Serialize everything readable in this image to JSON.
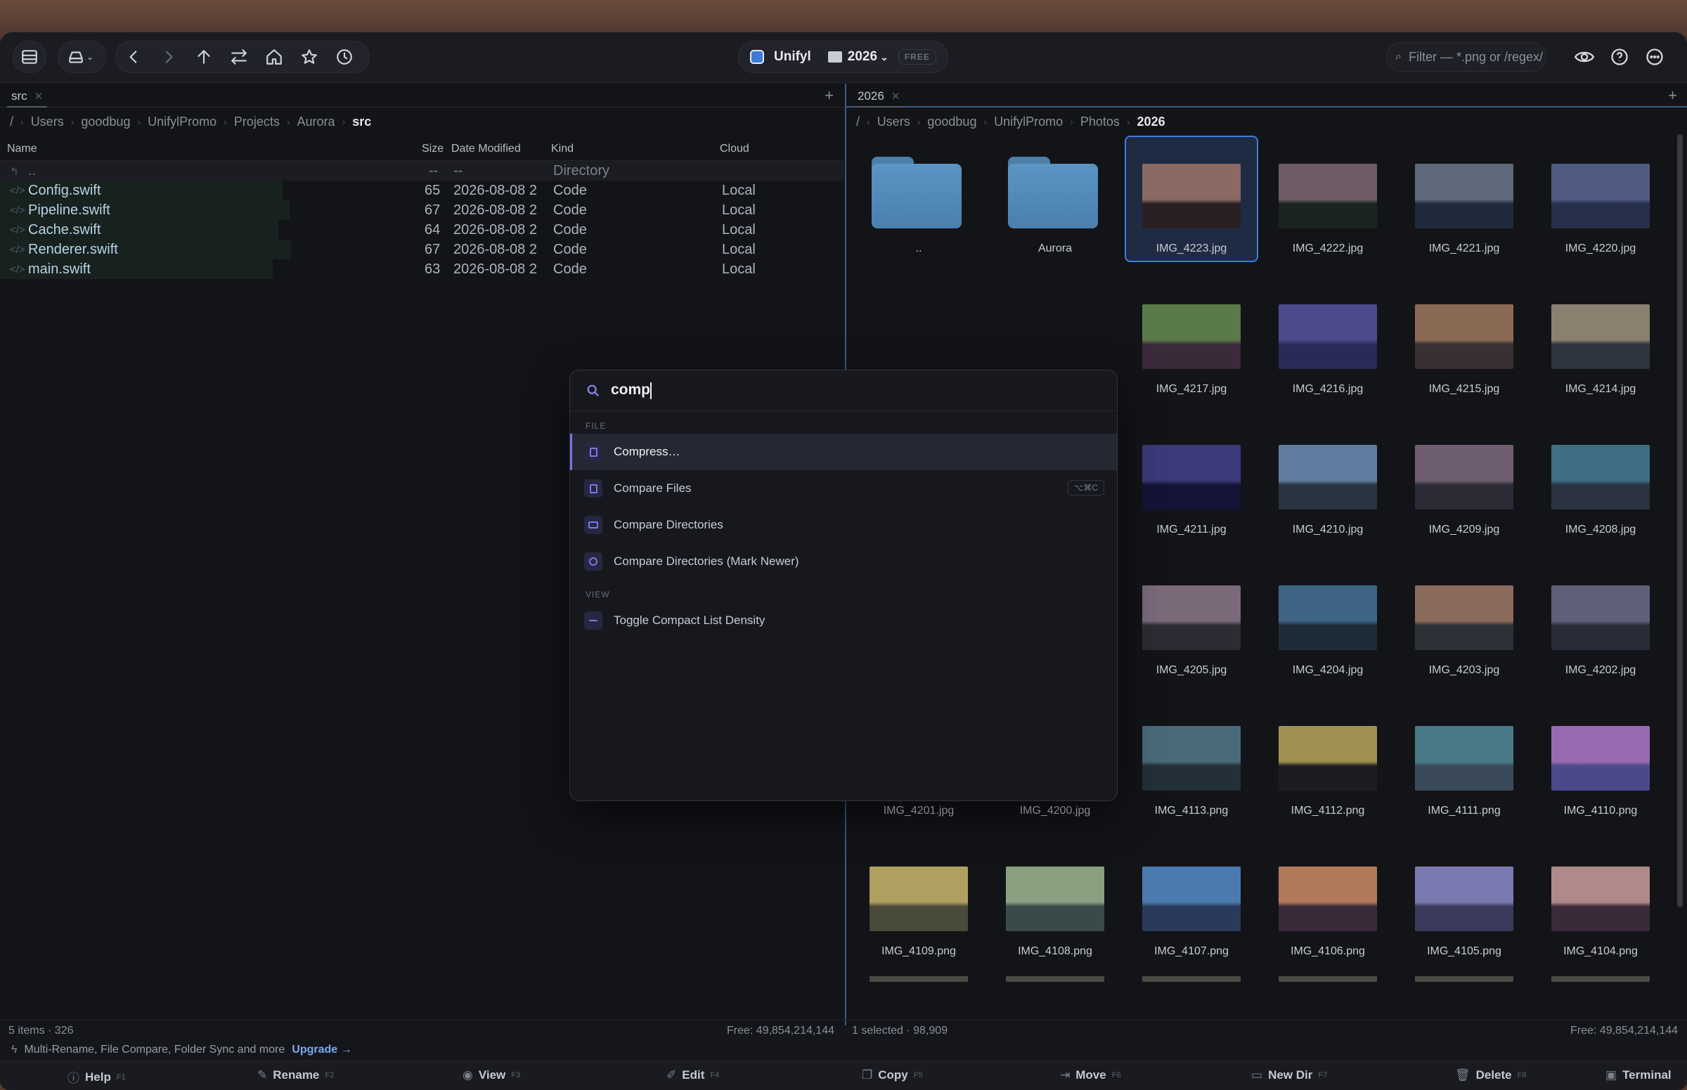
{
  "toolbar": {
    "app_name": "Unifyl",
    "folder": "2026",
    "badge": "FREE",
    "filter_placeholder": "Filter — *.png or /regex/"
  },
  "left": {
    "tab": "src",
    "crumbs": [
      "/",
      "Users",
      "goodbug",
      "UnifylPromo",
      "Projects",
      "Aurora",
      "src"
    ],
    "columns": {
      "name": "Name",
      "size": "Size",
      "modified": "Date Modified",
      "kind": "Kind",
      "cloud": "Cloud"
    },
    "parent": {
      "name": "..",
      "size": "--",
      "modified": "--",
      "kind": "Directory"
    },
    "rows": [
      {
        "name": "Config.swift",
        "size": "65",
        "modified": "2026-08-08 2",
        "kind": "Code",
        "cloud": "Local"
      },
      {
        "name": "Pipeline.swift",
        "size": "67",
        "modified": "2026-08-08 2",
        "kind": "Code",
        "cloud": "Local"
      },
      {
        "name": "Cache.swift",
        "size": "64",
        "modified": "2026-08-08 2",
        "kind": "Code",
        "cloud": "Local"
      },
      {
        "name": "Renderer.swift",
        "size": "67",
        "modified": "2026-08-08 2",
        "kind": "Code",
        "cloud": "Local"
      },
      {
        "name": "main.swift",
        "size": "63",
        "modified": "2026-08-08 2",
        "kind": "Code",
        "cloud": "Local"
      }
    ],
    "status_left": "5 items · 326",
    "status_right": "Free: 49,854,214,144"
  },
  "right": {
    "tab": "2026",
    "crumbs": [
      "/",
      "Users",
      "goodbug",
      "UnifylPromo",
      "Photos",
      "2026"
    ],
    "folders": [
      "..",
      "Aurora"
    ],
    "files": [
      "IMG_4223.jpg",
      "IMG_4222.jpg",
      "IMG_4221.jpg",
      "IMG_4220.jpg",
      "IMG_4217.jpg",
      "IMG_4216.jpg",
      "IMG_4215.jpg",
      "IMG_4214.jpg",
      "IMG_4211.jpg",
      "IMG_4210.jpg",
      "IMG_4209.jpg",
      "IMG_4208.jpg",
      "IMG_4205.jpg",
      "IMG_4204.jpg",
      "IMG_4203.jpg",
      "IMG_4202.jpg",
      "IMG_4201.jpg",
      "IMG_4200.jpg",
      "IMG_4113.png",
      "IMG_4112.png",
      "IMG_4111.png",
      "IMG_4110.png",
      "IMG_4109.png",
      "IMG_4108.png",
      "IMG_4107.png",
      "IMG_4106.png",
      "IMG_4105.png",
      "IMG_4104.png"
    ],
    "status_left": "1 selected · 98,909",
    "status_right": "Free: 49,854,214,144"
  },
  "palette": {
    "query": "comp",
    "sections": [
      {
        "title": "FILE",
        "items": [
          {
            "label": "Compress…",
            "shortcut": ""
          },
          {
            "label": "Compare Files",
            "shortcut": "⌥⌘C"
          },
          {
            "label": "Compare Directories",
            "shortcut": ""
          },
          {
            "label": "Compare Directories (Mark Newer)",
            "shortcut": ""
          }
        ]
      },
      {
        "title": "VIEW",
        "items": [
          {
            "label": "Toggle Compact List Density",
            "shortcut": ""
          }
        ]
      }
    ]
  },
  "promo": {
    "text": "Multi-Rename, File Compare, Folder Sync and more",
    "link": "Upgrade →"
  },
  "fkeys": [
    {
      "label": "Help",
      "key": "F1"
    },
    {
      "label": "Rename",
      "key": "F2"
    },
    {
      "label": "View",
      "key": "F3"
    },
    {
      "label": "Edit",
      "key": "F4"
    },
    {
      "label": "Copy",
      "key": "F5"
    },
    {
      "label": "Move",
      "key": "F6"
    },
    {
      "label": "New Dir",
      "key": "F7"
    },
    {
      "label": "Delete",
      "key": "F8"
    },
    {
      "label": "Terminal",
      "key": ""
    }
  ]
}
